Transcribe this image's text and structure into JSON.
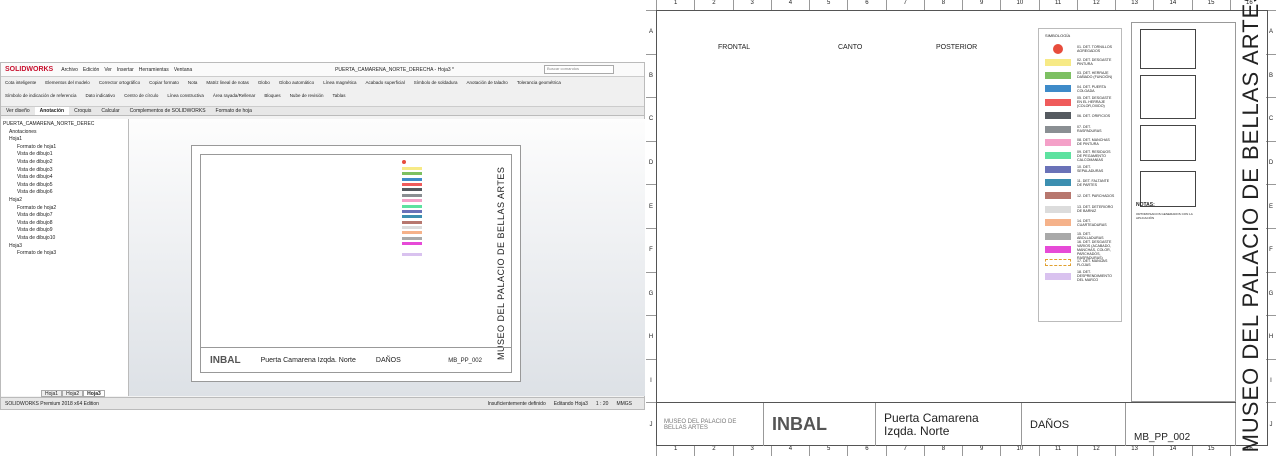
{
  "sw": {
    "logo": "SOLIDWORKS",
    "menus": [
      "Archivo",
      "Edición",
      "Ver",
      "Insertar",
      "Herramientas",
      "Ventana"
    ],
    "doc_title": "PUERTA_CAMARENA_NORTE_DERECHA - Hoja3 *",
    "search_placeholder": "Buscar comandos",
    "ribbon": [
      "Cota inteligente",
      "Elementos del modelo",
      "Corrector ortográfico",
      "Copiar formato",
      "Nota",
      "Matriz lineal de notas",
      "Globo",
      "Globo automático",
      "Línea magnética",
      "Acabado superficial",
      "Símbolo de soldadura",
      "Anotación de taladro",
      "Tolerancia geométrica",
      "Símbolo de indicación de referencia",
      "Dato indicativo",
      "Centro de círculo",
      "Línea constructiva",
      "Área rayada/Rellenar",
      "Bloques",
      "Nube de revisión",
      "Tablas"
    ],
    "tabs": [
      "Ver diseño",
      "Anotación",
      "Croquis",
      "Calcular",
      "Complementos de SOLIDWORKS",
      "Formato de hoja"
    ],
    "active_tab": "Anotación",
    "tree": [
      "PUERTA_CAMARENA_NORTE_DEREC",
      "Anotaciones",
      "Hoja1",
      "Formato de hoja1",
      "Vista de dibujo1",
      "Vista de dibujo2",
      "Vista de dibujo3",
      "Vista de dibujo4",
      "Vista de dibujo5",
      "Vista de dibujo6",
      "Hoja2",
      "Formato de hoja2",
      "Vista de dibujo7",
      "Vista de dibujo8",
      "Vista de dibujo9",
      "Vista de dibujo10",
      "Hoja3",
      "Formato de hoja3"
    ],
    "sheet_tabs": [
      "Hoja1",
      "Hoja2",
      "Hoja3"
    ],
    "status": [
      "SOLIDWORKS Premium 2018 x64 Edition",
      "Insuficientemente definido",
      "Editando Hoja3",
      "1 : 20",
      "MMGS"
    ]
  },
  "sheet": {
    "columns": [
      "1",
      "2",
      "3",
      "4",
      "5",
      "6",
      "7",
      "8",
      "9",
      "10",
      "11",
      "12",
      "13",
      "14",
      "15",
      "16"
    ],
    "rows": [
      "A",
      "B",
      "C",
      "D",
      "E",
      "F",
      "G",
      "H",
      "I",
      "J"
    ],
    "views": [
      "FRONTAL",
      "CANTO",
      "POSTERIOR"
    ],
    "legend_title": "SIMBOLOGÍA",
    "legend": [
      {
        "label": "01. DET. TORNILLOS AGREGADOS",
        "color": "#e74c3c",
        "shape": "circle"
      },
      {
        "label": "02. DET. DESGASTE PINTURA",
        "color": "#f7ea86"
      },
      {
        "label": "03. DET. HERRAJE DAÑADO (FUNCIÓN)",
        "color": "#7dc062"
      },
      {
        "label": "04. DET. PUERTA COLGADA",
        "color": "#3e8bc9"
      },
      {
        "label": "05. DET. DESGASTE EN EL HERRAJE (COLOR,OXIDO)",
        "color": "#ef5b5b"
      },
      {
        "label": "06. DET. ORIFICIOS",
        "color": "#555a60"
      },
      {
        "label": "07. DET. RASPADURAS",
        "color": "#8a8f93"
      },
      {
        "label": "08. DET. MANCHAS DE PINTURA",
        "color": "#f4a0c8"
      },
      {
        "label": "09. DET. RESIDUOS DE PEGAMENTO CALCOMANÍAS",
        "color": "#5de2a0"
      },
      {
        "label": "10. DET. SEPALADURAS",
        "color": "#6a72b8"
      },
      {
        "label": "11. DET. FALTANTE DE PARTES",
        "color": "#3c8fb0"
      },
      {
        "label": "12. DET. PARCHADOS",
        "color": "#b7776e"
      },
      {
        "label": "13. DET. DETERIORO DE BARNIZ",
        "color": "#dcdcdc"
      },
      {
        "label": "14. DET. CUARTEADURAS",
        "color": "#f5b28a"
      },
      {
        "label": "15. DET. ABOLLADURAS",
        "color": "#a9a9a9"
      },
      {
        "label": "16. DET. DESGASTE VARIOS (ACABADO, MANCHAS, COLOR, PARCHADOS, RASPADURAS)",
        "color": "#e64ad7"
      },
      {
        "label": "17. DET. MANIJAS FLOJAS",
        "color": "#ffffff",
        "shape": "dashed",
        "border": "#e0a030"
      },
      {
        "label": "18. DET. DESPRENDIMIENTO DEL MARCO",
        "color": "#d9c2ef"
      }
    ],
    "notes_title": "NOTAS:",
    "notes_body": "ORTOMOSAICOS GENERADOS CON LA APLICACIÓN",
    "vertical_title": "MUSEO DEL PALACIO DE BELLAS ARTES",
    "museo_logo": "MUSEO DEL PALACIO DE BELLAS ARTES",
    "inbal": "INBAL",
    "name": "Puerta Camarena Izqda. Norte",
    "danos": "DAÑOS",
    "code": "MB_PP_002"
  }
}
